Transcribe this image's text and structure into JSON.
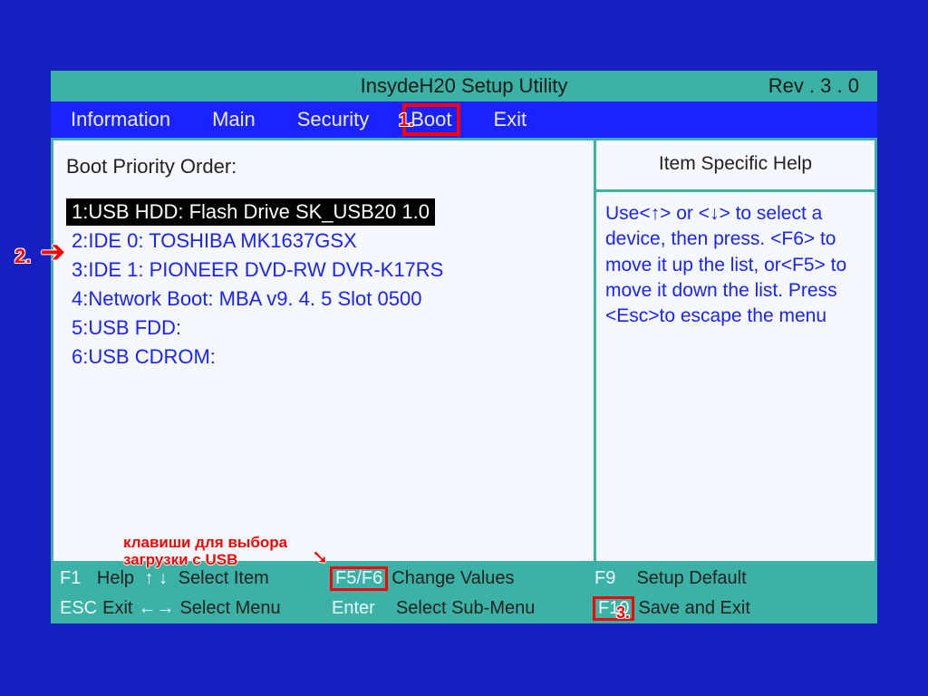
{
  "header": {
    "title": "InsydeH20  Setup  Utility",
    "revision": "Rev . 3  . 0"
  },
  "tabs": {
    "information": "Information",
    "main": "Main",
    "security": "Security",
    "boot": "Boot",
    "exit": "Exit",
    "selected": "Boot"
  },
  "main": {
    "title": "Boot Priority Order:",
    "items": [
      "1:USB HDD:  Flash Drive  SK_USB20  1.0",
      "2:IDE 0: TOSHIBA MK1637GSX",
      "3:IDE 1: PIONEER DVD-RW  DVR-K17RS",
      "4:Network Boot:  MBA  v9. 4. 5  Slot  0500",
      "5:USB FDD:",
      "6:USB CDROM:"
    ],
    "highlighted_index": 0
  },
  "help": {
    "title": "Item Specific Help",
    "text": "Use<↑> or <↓> to select a device,  then press. <F6> to move it up the list, or<F5> to move it down the list. Press <Esc>to escape the menu"
  },
  "footer": {
    "f1": "F1",
    "help": "Help",
    "select_item": "Select Item",
    "f5f6": "F5/F6",
    "change_values": "Change Values",
    "f9": "F9",
    "setup_default": "Setup Default",
    "esc": "ESC",
    "exit": "Exit",
    "select_menu": "Select Menu",
    "enter": "Enter",
    "select_sub": "Select  Sub-Menu",
    "f10": "F10",
    "save_exit": "Save and Exit"
  },
  "annotations": {
    "n1": "1.",
    "n2": "2.",
    "n3": "3.",
    "caption_line1": "клавиши для выбора",
    "caption_line2": "загрузки с USB"
  }
}
